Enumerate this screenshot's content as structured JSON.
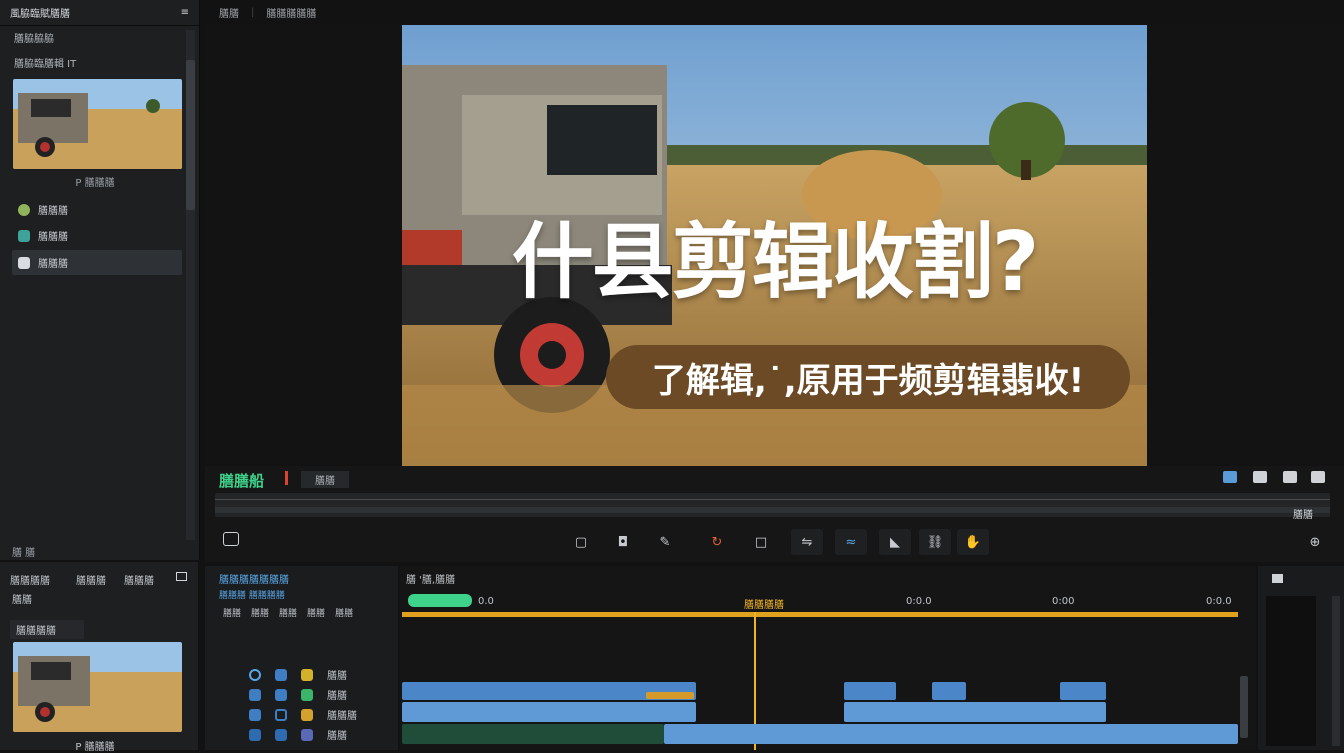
{
  "app": {
    "title": "風脇臨賦膳膳",
    "menu_icon": "hamburger-icon"
  },
  "left_panel": {
    "section_label": "膳脇脇脇",
    "media_label": "膳脇臨膳輯 IT",
    "thumb_caption": "P 膳膳膳",
    "nav": [
      {
        "label": "膳膳膳",
        "icon": "effects-icon",
        "color": "#8fb35a"
      },
      {
        "label": "膳膳膳",
        "icon": "transitions-icon",
        "color": "#3fa39a"
      },
      {
        "label": "膳膳膳",
        "icon": "text-icon",
        "color": "#d9dde2"
      }
    ],
    "footer_label": "膳 膳"
  },
  "topbar": {
    "left_label": "膳膳",
    "right_label": "膳膳膳膳膳"
  },
  "video": {
    "title": "什县剪辑收割?",
    "subtitle": "了解辑,˙,原用于频剪辑翡收!"
  },
  "transport": {
    "brand": "膳膳船",
    "tab_label": "膳膳",
    "timecode_end": "膳膳",
    "buttons": [
      "clip-icon",
      "crop-icon",
      "pen-icon",
      "loop-icon",
      "frame-icon",
      "split-icon",
      "audio-icon",
      "mark-icon",
      "link-icon",
      "hand-icon"
    ]
  },
  "bottom_left": {
    "header": [
      "膳膳膳膳",
      "膳膳膳",
      "膳膳膳"
    ],
    "row2": "膳膳",
    "label": "膳膳膳膳",
    "caption": "P 膳膳膳"
  },
  "tracks": {
    "title": "膳膳膳膳膳膳膳",
    "subtitle": "膳膳膳 膳膳膳膳",
    "tools": [
      "膳膳",
      "膳膳",
      "膳膳",
      "膳膳",
      "膳膳"
    ],
    "rows": [
      {
        "label": "膳膳",
        "color": "#d4b12a"
      },
      {
        "label": "膳膳",
        "color": "#3ab56a"
      },
      {
        "label": "膳膳膳",
        "color": "#d3a22c"
      },
      {
        "label": "膳膳",
        "color": "#5a68b8"
      }
    ]
  },
  "timeline": {
    "header": "膳 '膳,膳膳",
    "playhead_label": "膳膳膳膳",
    "marks": [
      "0.0",
      "0:0.0",
      "0:00",
      "0:0.0"
    ],
    "accent": "#f0b429",
    "clip_color": "#4b86c8"
  }
}
